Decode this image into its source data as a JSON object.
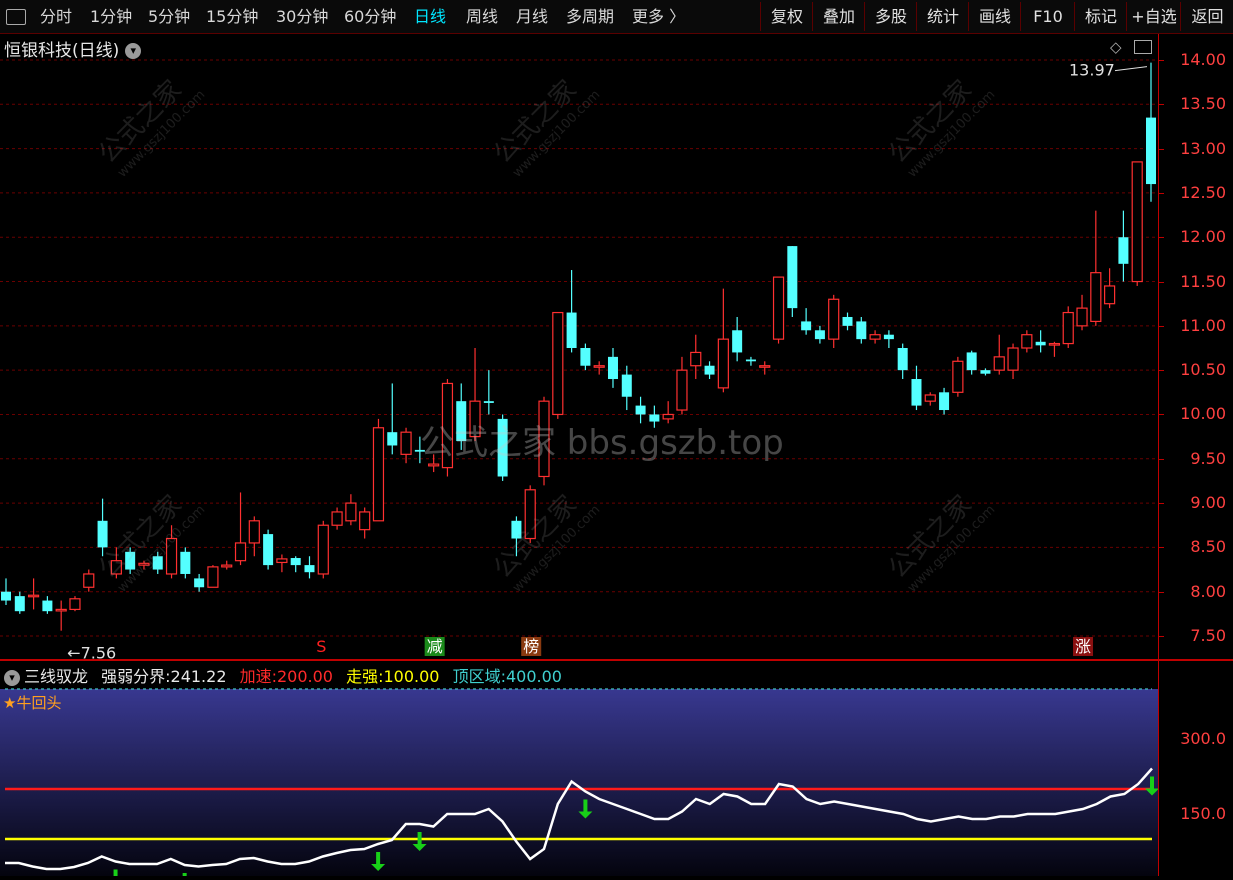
{
  "toolbar": {
    "items": [
      {
        "label": "分时"
      },
      {
        "label": "1分钟"
      },
      {
        "label": "5分钟"
      },
      {
        "label": "15分钟"
      },
      {
        "label": "30分钟"
      },
      {
        "label": "60分钟"
      },
      {
        "label": "日线",
        "active": true
      },
      {
        "label": "周线"
      },
      {
        "label": "月线"
      },
      {
        "label": "多周期"
      },
      {
        "label": "更多 〉"
      }
    ],
    "buttons": [
      {
        "label": "复权"
      },
      {
        "label": "叠加"
      },
      {
        "label": "多股"
      },
      {
        "label": "统计"
      },
      {
        "label": "画线"
      },
      {
        "label": "F10"
      },
      {
        "label": "标记"
      },
      {
        "label": "+自选"
      },
      {
        "label": "返回"
      }
    ]
  },
  "main": {
    "title": "恒银科技(日线)",
    "high_label": "13.97",
    "low_label": "7.56",
    "watermark_center": "公式之家 bbs.gszb.top",
    "watermark_cn": "公式之家",
    "watermark_url": "www.gszj100.com",
    "signals": [
      {
        "text": "S",
        "color": "#ff2020",
        "bg": "#000"
      },
      {
        "text": "减",
        "color": "#ffffff",
        "bg": "#1a8a1a"
      },
      {
        "text": "榜",
        "color": "#ffffff",
        "bg": "#8a3a10"
      },
      {
        "text": "涨",
        "color": "#ffffff",
        "bg": "#8a1010"
      }
    ]
  },
  "indicator": {
    "name": "三线驭龙",
    "strong_weak_label": "强弱分界:",
    "strong_weak_value": "241.22",
    "accel_label": "加速:",
    "accel_value": "200.00",
    "strong_label": "走强:",
    "strong_value": "100.00",
    "top_label": "顶区域:",
    "top_value": "400.00",
    "signal_text": "★牛回头"
  },
  "colors": {
    "up": "#ff3030",
    "down": "#54ffff",
    "accel": "#ff1a1a",
    "strong": "#ffff00",
    "top": "#40c0c0",
    "line": "#ffffff",
    "arrow": "#18d018"
  },
  "chart_data": [
    {
      "type": "candlestick",
      "ylim": [
        7.3,
        14.2
      ],
      "yticks": [
        "14.00",
        "13.50",
        "13.00",
        "12.50",
        "12.00",
        "11.50",
        "11.00",
        "10.50",
        "10.00",
        "9.50",
        "9.00",
        "8.50",
        "8.00",
        "7.50"
      ],
      "ytick_values": [
        14.0,
        13.5,
        13.0,
        12.5,
        12.0,
        11.5,
        11.0,
        10.5,
        10.0,
        9.5,
        9.0,
        8.5,
        8.0,
        7.5
      ],
      "candles": [
        [
          8.0,
          7.9,
          8.15,
          7.85
        ],
        [
          7.95,
          7.78,
          8.0,
          7.75
        ],
        [
          7.95,
          7.96,
          8.15,
          7.8
        ],
        [
          7.9,
          7.78,
          7.95,
          7.75
        ],
        [
          7.8,
          7.8,
          7.9,
          7.56
        ],
        [
          7.8,
          7.92,
          7.95,
          7.78
        ],
        [
          8.05,
          8.2,
          8.25,
          8.0
        ],
        [
          8.8,
          8.5,
          9.05,
          8.4
        ],
        [
          8.2,
          8.35,
          8.5,
          8.15
        ],
        [
          8.45,
          8.25,
          8.5,
          8.2
        ],
        [
          8.3,
          8.32,
          8.35,
          8.25
        ],
        [
          8.4,
          8.25,
          8.45,
          8.2
        ],
        [
          8.2,
          8.6,
          8.75,
          8.15
        ],
        [
          8.45,
          8.2,
          8.5,
          8.15
        ],
        [
          8.15,
          8.05,
          8.2,
          8.0
        ],
        [
          8.05,
          8.28,
          8.3,
          8.05
        ],
        [
          8.28,
          8.3,
          8.35,
          8.25
        ],
        [
          8.35,
          8.55,
          9.12,
          8.3
        ],
        [
          8.55,
          8.8,
          8.85,
          8.4
        ],
        [
          8.65,
          8.3,
          8.7,
          8.25
        ],
        [
          8.33,
          8.37,
          8.42,
          8.22
        ],
        [
          8.38,
          8.3,
          8.4,
          8.22
        ],
        [
          8.3,
          8.22,
          8.4,
          8.15
        ],
        [
          8.2,
          8.75,
          8.8,
          8.15
        ],
        [
          8.75,
          8.9,
          8.95,
          8.7
        ],
        [
          8.8,
          9.0,
          9.1,
          8.75
        ],
        [
          8.7,
          8.9,
          8.95,
          8.6
        ],
        [
          8.8,
          9.85,
          9.95,
          8.8
        ],
        [
          9.8,
          9.65,
          10.35,
          9.55
        ],
        [
          9.55,
          9.8,
          9.85,
          9.45
        ],
        [
          9.6,
          9.58,
          9.75,
          9.45
        ],
        [
          9.42,
          9.44,
          9.55,
          9.35
        ],
        [
          9.4,
          10.35,
          10.4,
          9.3
        ],
        [
          10.15,
          9.7,
          10.35,
          9.6
        ],
        [
          9.75,
          10.15,
          10.75,
          9.7
        ],
        [
          10.15,
          10.13,
          10.5,
          10.0
        ],
        [
          9.95,
          9.3,
          10.0,
          9.25
        ],
        [
          8.8,
          8.6,
          8.85,
          8.4
        ],
        [
          8.6,
          9.15,
          9.2,
          8.55
        ],
        [
          9.3,
          10.15,
          10.2,
          9.2
        ],
        [
          10.0,
          11.15,
          11.15,
          9.95
        ],
        [
          11.15,
          10.75,
          11.63,
          10.7
        ],
        [
          10.75,
          10.55,
          10.8,
          10.5
        ],
        [
          10.55,
          10.55,
          10.6,
          10.45
        ],
        [
          10.65,
          10.4,
          10.75,
          10.3
        ],
        [
          10.45,
          10.2,
          10.55,
          10.05
        ],
        [
          10.1,
          10.0,
          10.2,
          9.9
        ],
        [
          10.0,
          9.92,
          10.1,
          9.85
        ],
        [
          9.95,
          10.0,
          10.15,
          9.9
        ],
        [
          10.05,
          10.5,
          10.65,
          10.0
        ],
        [
          10.55,
          10.7,
          10.9,
          10.4
        ],
        [
          10.55,
          10.45,
          10.6,
          10.4
        ],
        [
          10.3,
          10.85,
          11.42,
          10.25
        ],
        [
          10.95,
          10.7,
          11.1,
          10.6
        ],
        [
          10.62,
          10.6,
          10.65,
          10.55
        ],
        [
          10.55,
          10.55,
          10.6,
          10.45
        ],
        [
          10.85,
          11.55,
          11.55,
          10.8
        ],
        [
          11.9,
          11.2,
          11.9,
          11.1
        ],
        [
          11.05,
          10.95,
          11.2,
          10.9
        ],
        [
          10.95,
          10.85,
          11.0,
          10.8
        ],
        [
          10.85,
          11.3,
          11.35,
          10.75
        ],
        [
          11.1,
          11.0,
          11.15,
          10.95
        ],
        [
          11.05,
          10.85,
          11.1,
          10.8
        ],
        [
          10.85,
          10.9,
          10.95,
          10.8
        ],
        [
          10.9,
          10.85,
          10.95,
          10.75
        ],
        [
          10.75,
          10.5,
          10.8,
          10.4
        ],
        [
          10.4,
          10.1,
          10.55,
          10.05
        ],
        [
          10.15,
          10.22,
          10.25,
          10.1
        ],
        [
          10.25,
          10.05,
          10.3,
          10.0
        ],
        [
          10.25,
          10.6,
          10.65,
          10.2
        ],
        [
          10.7,
          10.5,
          10.72,
          10.45
        ],
        [
          10.5,
          10.46,
          10.52,
          10.44
        ],
        [
          10.5,
          10.65,
          10.9,
          10.45
        ],
        [
          10.5,
          10.75,
          10.8,
          10.4
        ],
        [
          10.75,
          10.9,
          10.95,
          10.7
        ],
        [
          10.82,
          10.78,
          10.95,
          10.7
        ],
        [
          10.8,
          10.8,
          10.82,
          10.65
        ],
        [
          10.8,
          11.15,
          11.22,
          10.75
        ],
        [
          11.0,
          11.2,
          11.35,
          10.95
        ],
        [
          11.05,
          11.6,
          12.3,
          11.0
        ],
        [
          11.25,
          11.45,
          11.65,
          11.2
        ],
        [
          12.0,
          11.7,
          12.3,
          11.5
        ],
        [
          11.5,
          12.85,
          12.85,
          11.45
        ],
        [
          13.35,
          12.6,
          13.97,
          12.4
        ]
      ]
    },
    {
      "type": "line",
      "ylim": [
        0,
        400
      ],
      "yticks": [
        "300.0",
        "150.0"
      ],
      "ytick_values": [
        300,
        150
      ],
      "series": [
        {
          "name": "强弱分界",
          "values": [
            52,
            52,
            45,
            40,
            40,
            44,
            52,
            65,
            55,
            50,
            50,
            50,
            60,
            48,
            45,
            48,
            50,
            60,
            62,
            55,
            50,
            50,
            55,
            65,
            72,
            78,
            80,
            90,
            98,
            130,
            130,
            125,
            150,
            150,
            150,
            160,
            135,
            95,
            60,
            80,
            170,
            215,
            195,
            180,
            170,
            160,
            150,
            140,
            140,
            155,
            180,
            170,
            190,
            185,
            170,
            170,
            210,
            205,
            180,
            170,
            175,
            170,
            165,
            160,
            155,
            150,
            140,
            135,
            140,
            145,
            140,
            140,
            145,
            145,
            150,
            150,
            150,
            155,
            160,
            170,
            185,
            190,
            210,
            241
          ]
        }
      ],
      "hlines": [
        {
          "name": "顶区域",
          "value": 400
        },
        {
          "name": "加速",
          "value": 200
        },
        {
          "name": "走强",
          "value": 100
        }
      ],
      "signal_arrows_at": [
        8,
        13,
        27,
        30,
        42,
        83
      ]
    }
  ]
}
